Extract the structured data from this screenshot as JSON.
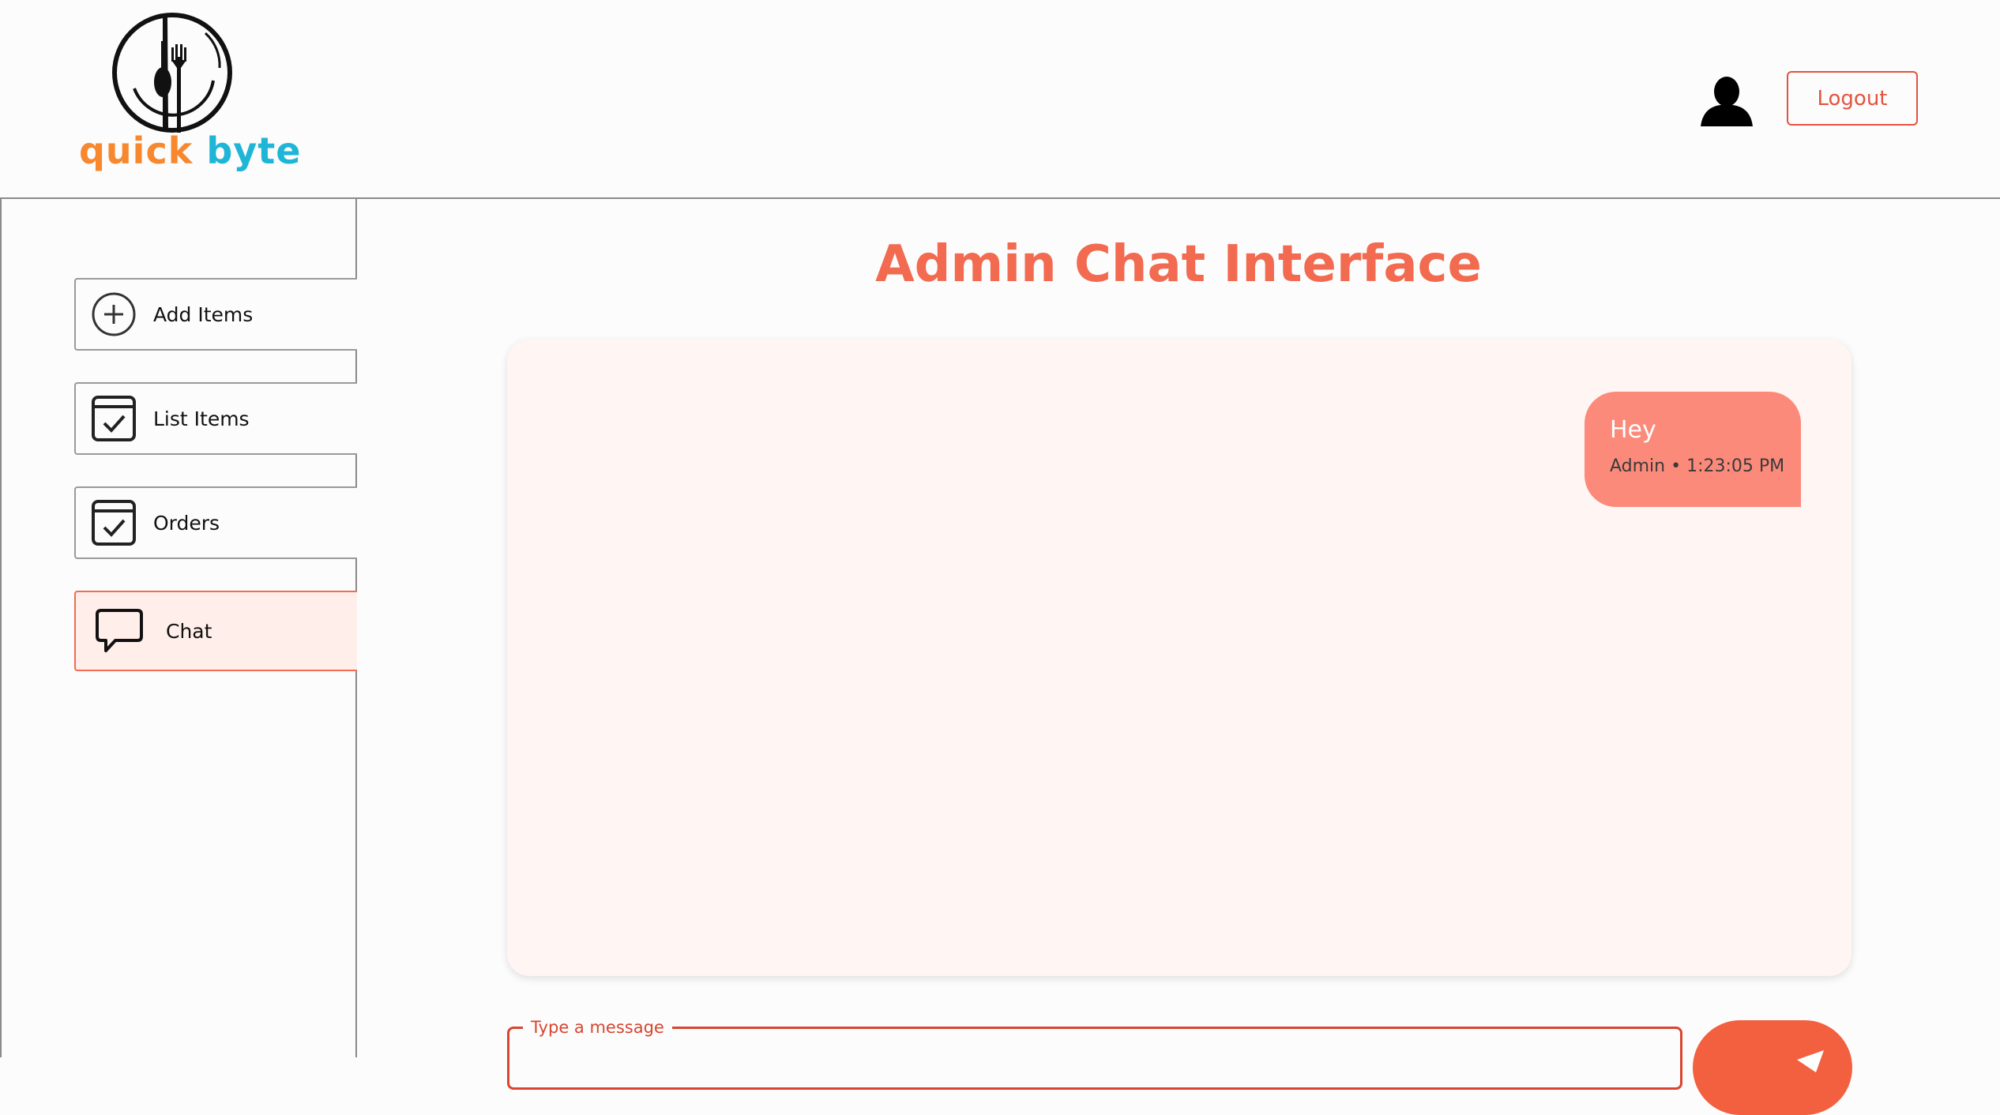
{
  "brand": {
    "logo_word1": "quick",
    "logo_word2": "byte"
  },
  "header": {
    "profile_icon": "user-silhouette-icon",
    "logout_label": "Logout"
  },
  "sidebar": {
    "items": [
      {
        "label": "Add Items",
        "icon": "plus-circle-icon",
        "active": false
      },
      {
        "label": "List Items",
        "icon": "calendar-check-icon",
        "active": false
      },
      {
        "label": "Orders",
        "icon": "calendar-check-icon",
        "active": false
      },
      {
        "label": "Chat",
        "icon": "chat-bubble-icon",
        "active": true
      }
    ]
  },
  "main": {
    "title": "Admin Chat Interface",
    "messages": [
      {
        "text": "Hey",
        "meta": "Admin • 1:23:05 PM"
      }
    ],
    "input": {
      "label": "Type a message",
      "value": ""
    },
    "send_icon": "send-arrow-icon"
  },
  "colors": {
    "accent": "#f26a50",
    "bubble": "#fc8a7b",
    "panel": "#fff5f3",
    "active_item_bg": "#ffeeea",
    "logo_orange": "#f7882e",
    "logo_blue": "#1fb5d6"
  }
}
